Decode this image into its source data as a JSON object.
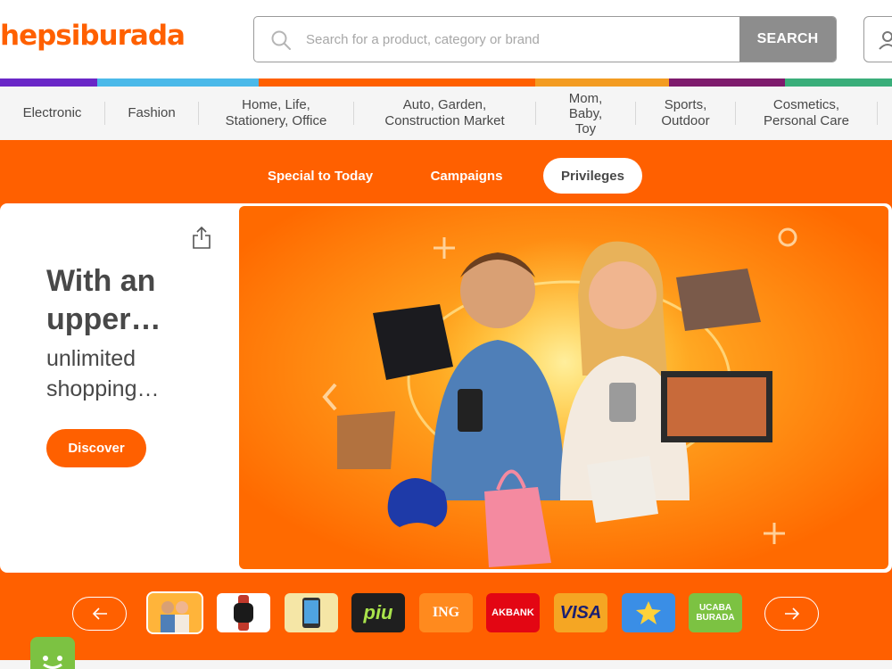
{
  "header": {
    "logo": "hepsiburada",
    "search": {
      "placeholder": "Search for a product, category or brand",
      "button_label": "SEARCH"
    }
  },
  "colors": {
    "brand": "#ff6000",
    "strip": [
      "#6a27c7",
      "#4bb9e9",
      "#ff6000",
      "#ff6000",
      "#f39c22",
      "#7e1b6d",
      "#3aae7a"
    ]
  },
  "categories": [
    {
      "label": "Electronic"
    },
    {
      "label": "Fashion"
    },
    {
      "label": "Home, Life,\nStationery, Office"
    },
    {
      "label": "Auto, Garden,\nConstruction Market"
    },
    {
      "label": "Mom,\nBaby,\nToy"
    },
    {
      "label": "Sports,\nOutdoor"
    },
    {
      "label": "Cosmetics,\nPersonal Care"
    }
  ],
  "tabs": [
    {
      "label": "Special to Today",
      "active": false
    },
    {
      "label": "Campaigns",
      "active": false
    },
    {
      "label": "Privileges",
      "active": true
    }
  ],
  "banner": {
    "title": "With an upper…",
    "subtitle": "unlimited shopping…",
    "button_label": "Discover"
  },
  "thumbnails": [
    {
      "name": "thumb-hero",
      "label": "",
      "selected": true
    },
    {
      "name": "thumb-watch",
      "label": "",
      "selected": false
    },
    {
      "name": "thumb-tablet",
      "label": "",
      "selected": false
    },
    {
      "name": "thumb-piu",
      "label": "piu",
      "selected": false
    },
    {
      "name": "thumb-ing",
      "label": "ING",
      "selected": false
    },
    {
      "name": "thumb-akbank",
      "label": "AKBANK",
      "selected": false
    },
    {
      "name": "thumb-visa",
      "label": "VISA",
      "selected": false
    },
    {
      "name": "thumb-star",
      "label": "",
      "selected": false
    },
    {
      "name": "thumb-ucaba",
      "label": "UCABA BURADA",
      "selected": false
    }
  ]
}
